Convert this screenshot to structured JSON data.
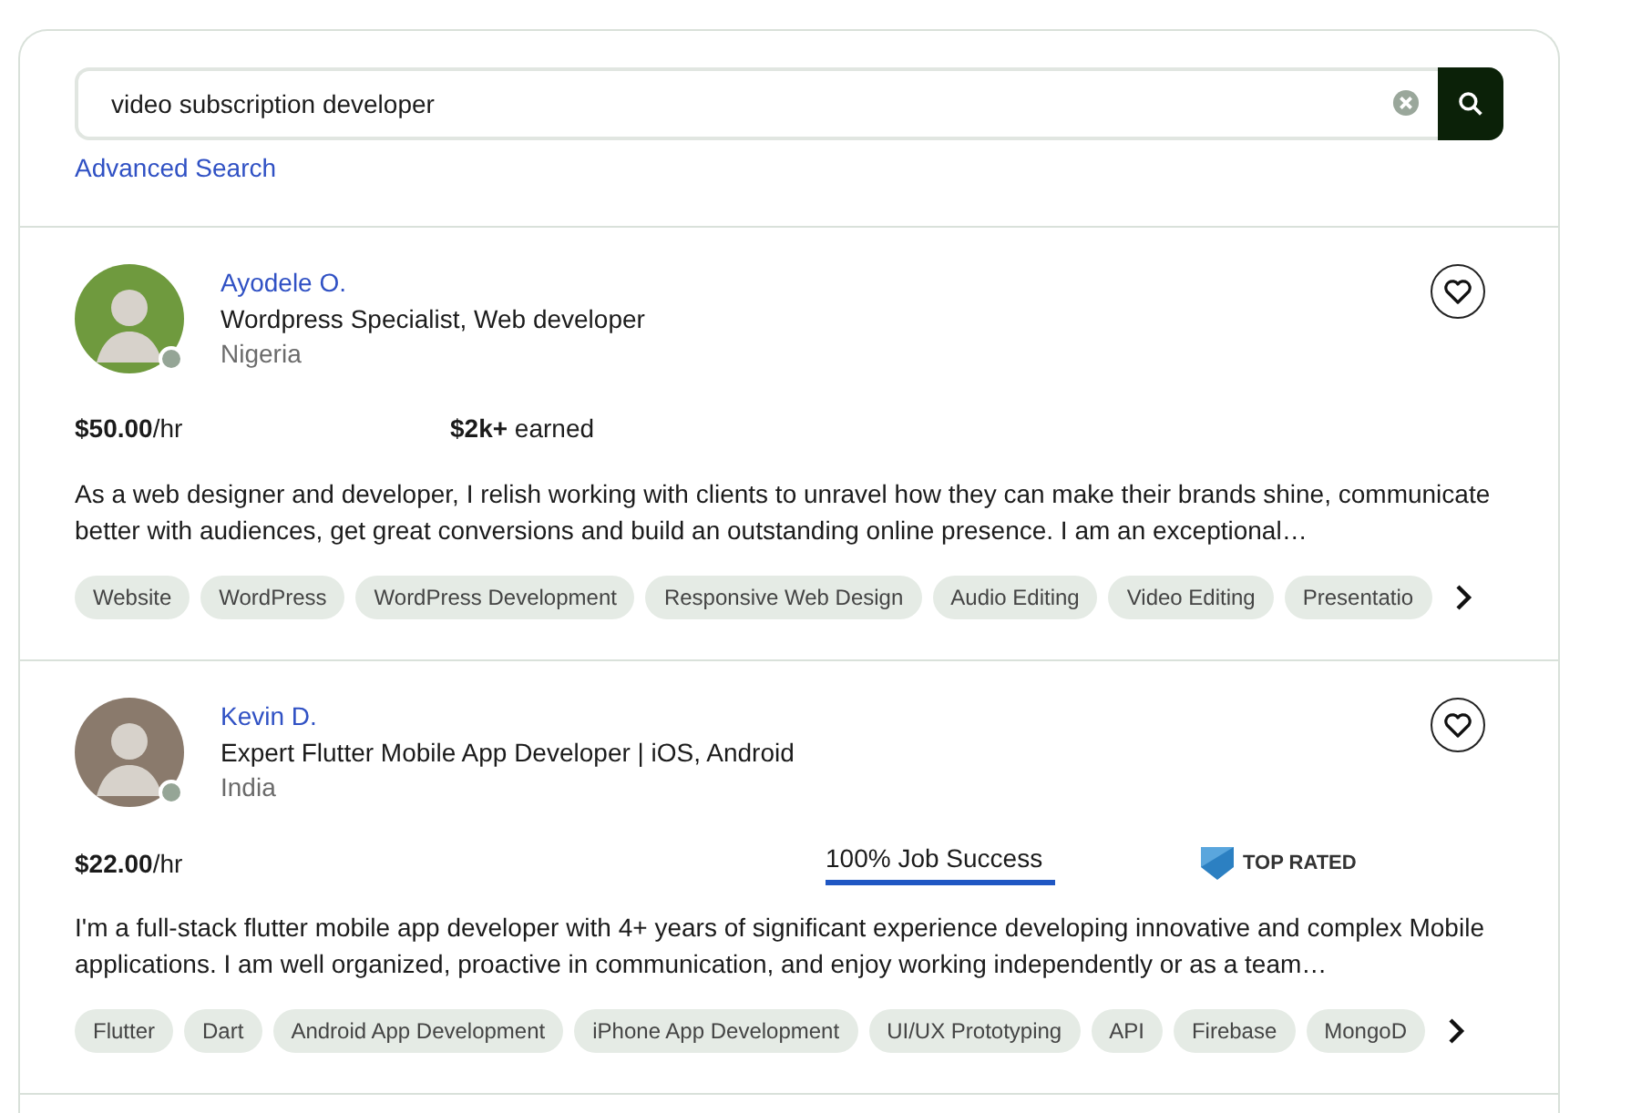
{
  "search": {
    "value": "video subscription developer",
    "advanced_link": "Advanced Search"
  },
  "profiles": [
    {
      "name": "Ayodele O.",
      "title": "Wordpress Specialist, Web developer",
      "location": "Nigeria",
      "rate": "**$50.00**/hr",
      "earned": "**$2k+** earned",
      "description": "As a web designer and developer, I relish working with clients to unravel how they can make their brands shine, communicate better with audiences, get great conversions and build an outstanding online presence. I am an exceptional…",
      "skills": [
        "Website",
        "WordPress",
        "WordPress Development",
        "Responsive Web Design",
        "Audio Editing",
        "Video Editing",
        "Presentatio"
      ]
    },
    {
      "name": "Kevin D.",
      "title": "Expert Flutter Mobile App Developer | iOS, Android",
      "location": "India",
      "rate": "**$22.00**/hr",
      "job_success": {
        "label": "100% Job Success",
        "level": 1
      },
      "badge": "TOP RATED",
      "description": "I'm a full-stack flutter mobile app developer with 4+ years of significant experience developing innovative and complex Mobile applications. I am well organized, proactive in communication, and enjoy working independently or as a team…",
      "skills": [
        "Flutter",
        "Dart",
        "Android App Development",
        "iPhone App Development",
        "UI/UX Prototyping",
        "API",
        "Firebase",
        "MongoD"
      ]
    }
  ]
}
